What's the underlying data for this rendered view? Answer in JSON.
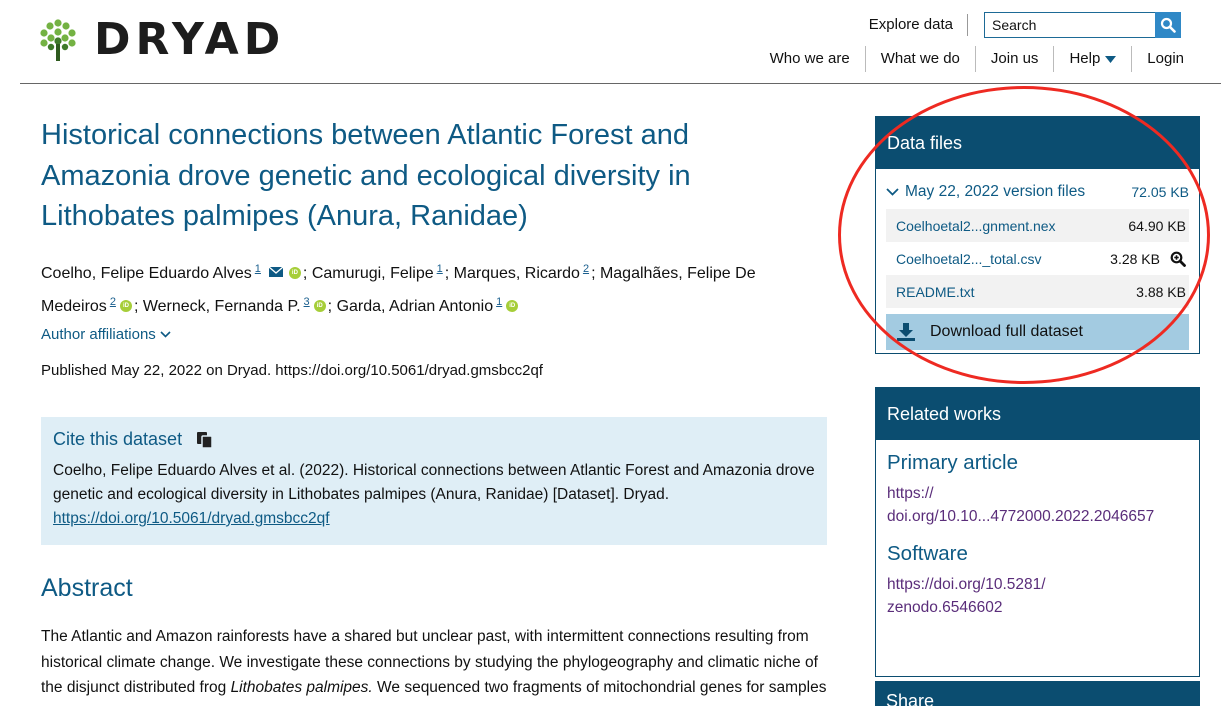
{
  "header": {
    "logo_text": "DRYAD",
    "explore_label": "Explore data",
    "search_placeholder": "Search",
    "nav": [
      "Who we are",
      "What we do",
      "Join us",
      "Help",
      "Login"
    ]
  },
  "dataset": {
    "title": "Historical connections between Atlantic Forest and Amazonia drove genetic and ecological diversity in Lithobates palmipes (Anura, Ranidae)",
    "authors": [
      {
        "name": "Coelho, Felipe Eduardo Alves",
        "affil": "1",
        "email": true,
        "orcid": true
      },
      {
        "name": "Camurugi, Felipe",
        "affil": "1",
        "email": false,
        "orcid": false
      },
      {
        "name": "Marques, Ricardo",
        "affil": "2",
        "email": false,
        "orcid": false
      },
      {
        "name": "Magalhães, Felipe De Medeiros",
        "affil": "2",
        "email": false,
        "orcid": true
      },
      {
        "name": "Werneck, Fernanda P.",
        "affil": "3",
        "email": false,
        "orcid": true
      },
      {
        "name": "Garda, Adrian Antonio",
        "affil": "1",
        "email": false,
        "orcid": true
      }
    ],
    "affiliations_label": "Author affiliations",
    "published": "Published May 22, 2022 on Dryad. https://doi.org/10.5061/dryad.gmsbcc2qf"
  },
  "cite": {
    "heading": "Cite this dataset",
    "text": "Coelho, Felipe Eduardo Alves et al. (2022). Historical connections between Atlantic Forest and Amazonia drove genetic and ecological diversity in Lithobates palmipes (Anura, Ranidae) [Dataset]. Dryad. ",
    "link": "https://doi.org/10.5061/dryad.gmsbcc2qf"
  },
  "abstract": {
    "heading": "Abstract",
    "text_before": "The Atlantic and Amazon rainforests have a shared but unclear past, with intermittent connections resulting from historical climate change. We investigate these connections by studying the phylogeography and climatic niche of the disjunct distributed frog ",
    "italic": "Lithobates palmipes.",
    "text_after": " We sequenced two fragments of mitochondrial genes for samples across Atlantic Forest and Amazonia and analysed the relationships among"
  },
  "data_files": {
    "heading": "Data files",
    "version_label": "May 22, 2022 version files",
    "version_size": "72.05 KB",
    "files": [
      {
        "name": "Coelhoetal2...gnment.nex",
        "size": "64.90 KB",
        "preview": false
      },
      {
        "name": "Coelhoetal2..._total.csv",
        "size": "3.28 KB",
        "preview": true
      },
      {
        "name": "README.txt",
        "size": "3.88 KB",
        "preview": false
      }
    ],
    "download_label": "Download full dataset"
  },
  "related": {
    "heading": "Related works",
    "primary_heading": "Primary article",
    "primary_link_1": "https://",
    "primary_link_2": "doi.org/10.10...4772000.2022.2046657",
    "software_heading": "Software",
    "software_link_1": "https://doi.org/10.5281/",
    "software_link_2": "zenodo.6546602"
  },
  "share": {
    "heading": "Share"
  },
  "colors": {
    "brand": "#0b4d70",
    "link": "#0e5a84",
    "visited": "#5a2d7a",
    "highlight": "#ee2a22",
    "orcid": "#a6ce39"
  }
}
